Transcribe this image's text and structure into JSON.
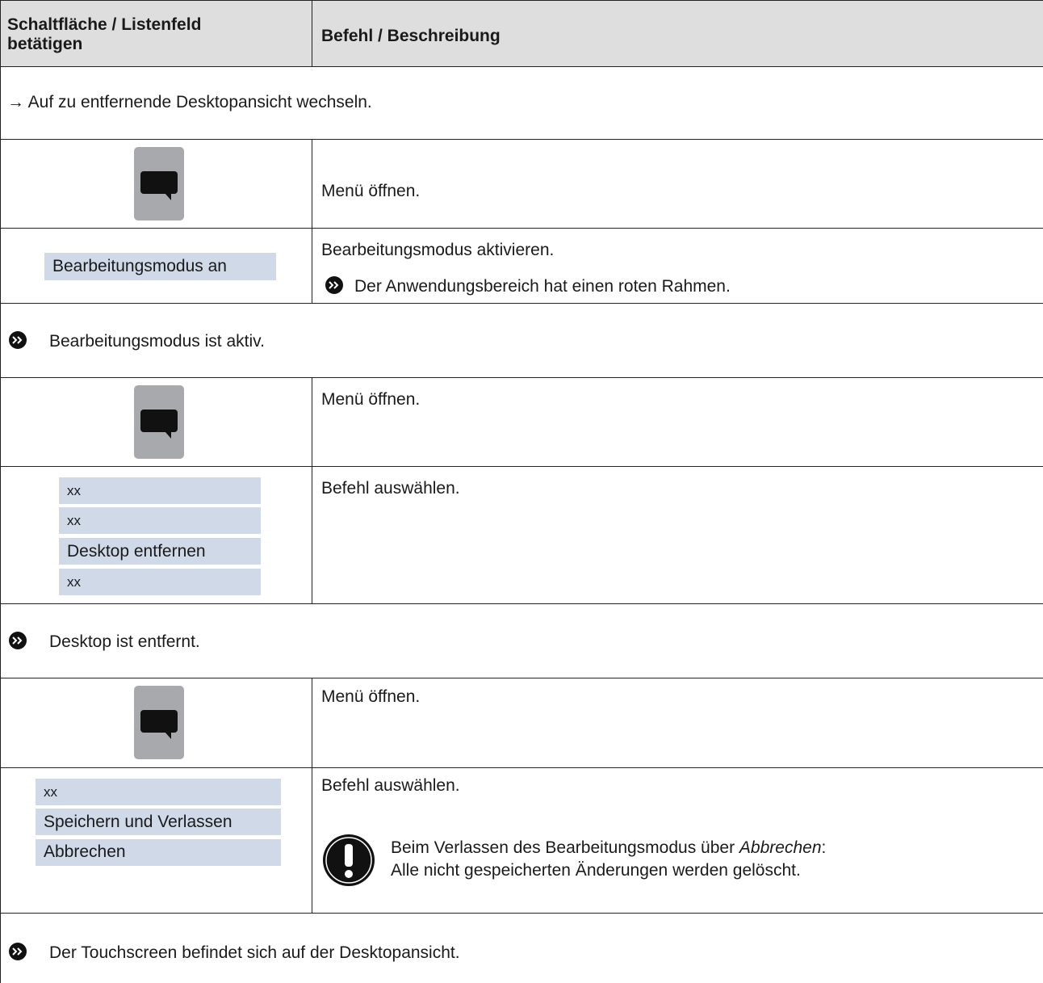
{
  "header": {
    "col1": [
      "Schaltfläche / Listenfeld",
      "betätigen"
    ],
    "col2": "Befehl / Beschreibung"
  },
  "steps": {
    "intro": "→ Auf zu entfernende Desktopansicht wechseln.",
    "menu_open": "Menü öffnen.",
    "edit_button": "Bearbeitungsmodus an",
    "edit_activate": "Bearbeitungsmodus aktivieren.",
    "edit_result": "Der Anwendungsbereich hat einen roten Rahmen.",
    "edit_active": "Bearbeitungsmodus ist aktiv.",
    "list1": [
      "xx",
      "xx",
      "Desktop entfernen",
      "xx"
    ],
    "select_command": "Befehl auswählen.",
    "desktop_removed": "Desktop ist entfernt.",
    "list2": [
      "xx",
      "Speichern und Verlassen",
      "Abbrechen"
    ],
    "warning_line1_pre": "Beim Verlassen des Bearbeitungsmodus über ",
    "warning_line1_em": "Abbrechen",
    "warning_line1_post": ":",
    "warning_line2": "Alle nicht gespeicherten Änderungen werden gelöscht.",
    "final": "Der Touchscreen befindet sich auf der Desktopansicht."
  },
  "icons": {
    "menu": "speech-bubble-icon",
    "result": "double-chevron-circle-icon",
    "warning": "exclamation-circle-icon"
  },
  "colors": {
    "header_bg": "#dedede",
    "list_item_bg": "#cfd9e8",
    "menu_button_bg": "#a7a9ac"
  }
}
